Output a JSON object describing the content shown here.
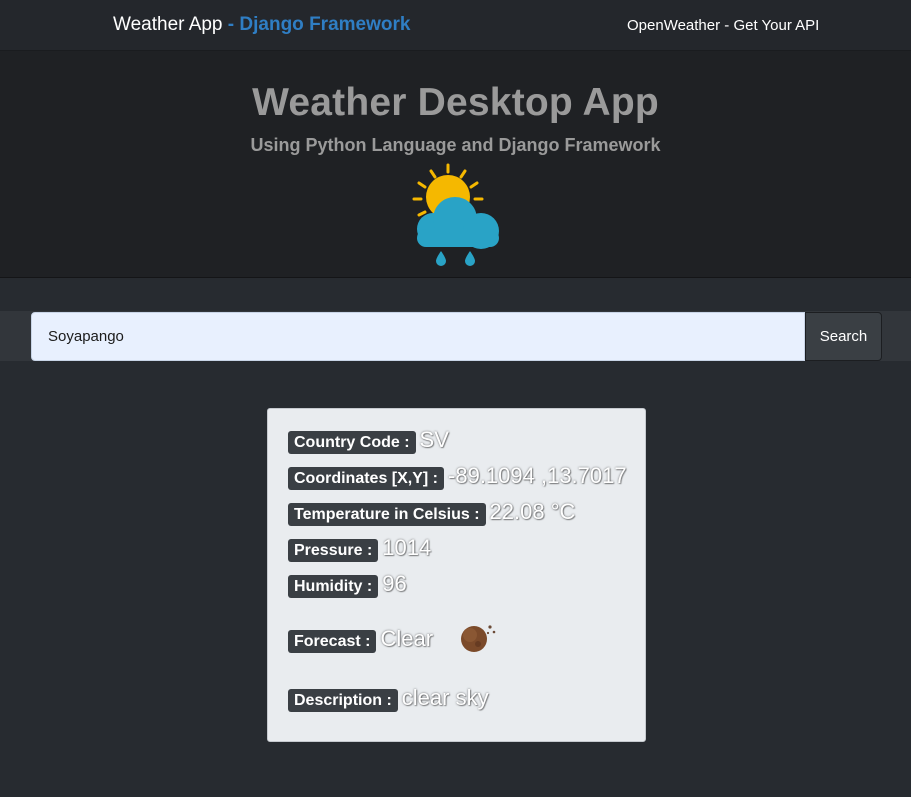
{
  "navbar": {
    "brand_main": "Weather App",
    "brand_accent": " - Django Framework",
    "link_label": "OpenWeather - Get Your API"
  },
  "hero": {
    "title": "Weather Desktop App",
    "subtitle": "Using Python Language and Django Framework",
    "icon": "sun-cloud-rain-icon"
  },
  "search": {
    "value": "Soyapango",
    "button_label": "Search"
  },
  "result": {
    "country_code_label": "Country Code :",
    "country_code_value": "SV",
    "coordinates_label": "Coordinates [X,Y] :",
    "coordinates_value": "-89.1094 ,13.7017",
    "temperature_label": "Temperature in Celsius :",
    "temperature_value": "22.08 °C",
    "pressure_label": "Pressure :",
    "pressure_value": "1014",
    "humidity_label": "Humidity :",
    "humidity_value": "96",
    "forecast_label": "Forecast :",
    "forecast_value": "Clear",
    "forecast_icon": "clear-night-moon-icon",
    "description_label": "Description :",
    "description_value": "clear sky"
  },
  "colors": {
    "page_bg": "#272b30",
    "navbar_bg": "#24272c",
    "hero_bg": "#1f2124",
    "brand_accent": "#2f7ec4",
    "card_bg": "#e9ecef",
    "tag_bg": "#3a3f44"
  }
}
